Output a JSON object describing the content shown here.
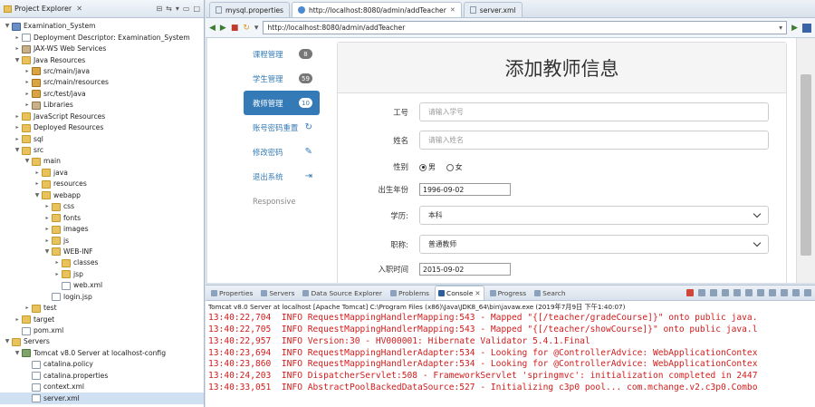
{
  "explorer": {
    "title": "Project Explorer",
    "tree": [
      {
        "label": "Examination_System",
        "depth": 0,
        "tw": "▼",
        "icon": "project"
      },
      {
        "label": "Deployment Descriptor: Examination_System",
        "depth": 1,
        "tw": "▸",
        "icon": "file"
      },
      {
        "label": "JAX-WS Web Services",
        "depth": 1,
        "tw": "▸",
        "icon": "lib"
      },
      {
        "label": "Java Resources",
        "depth": 1,
        "tw": "▼",
        "icon": "folder"
      },
      {
        "label": "src/main/java",
        "depth": 2,
        "tw": "▸",
        "icon": "pkg"
      },
      {
        "label": "src/main/resources",
        "depth": 2,
        "tw": "▸",
        "icon": "pkg"
      },
      {
        "label": "src/test/java",
        "depth": 2,
        "tw": "▸",
        "icon": "pkg"
      },
      {
        "label": "Libraries",
        "depth": 2,
        "tw": "▸",
        "icon": "lib"
      },
      {
        "label": "JavaScript Resources",
        "depth": 1,
        "tw": "▸",
        "icon": "folder"
      },
      {
        "label": "Deployed Resources",
        "depth": 1,
        "tw": "▸",
        "icon": "folder"
      },
      {
        "label": "sql",
        "depth": 1,
        "tw": "▸",
        "icon": "folder"
      },
      {
        "label": "src",
        "depth": 1,
        "tw": "▼",
        "icon": "folder"
      },
      {
        "label": "main",
        "depth": 2,
        "tw": "▼",
        "icon": "folder"
      },
      {
        "label": "java",
        "depth": 3,
        "tw": "▸",
        "icon": "folder"
      },
      {
        "label": "resources",
        "depth": 3,
        "tw": "▸",
        "icon": "folder"
      },
      {
        "label": "webapp",
        "depth": 3,
        "tw": "▼",
        "icon": "folder"
      },
      {
        "label": "css",
        "depth": 4,
        "tw": "▸",
        "icon": "folder"
      },
      {
        "label": "fonts",
        "depth": 4,
        "tw": "▸",
        "icon": "folder"
      },
      {
        "label": "images",
        "depth": 4,
        "tw": "▸",
        "icon": "folder"
      },
      {
        "label": "js",
        "depth": 4,
        "tw": "▸",
        "icon": "folder"
      },
      {
        "label": "WEB-INF",
        "depth": 4,
        "tw": "▼",
        "icon": "folder"
      },
      {
        "label": "classes",
        "depth": 5,
        "tw": "▸",
        "icon": "folder"
      },
      {
        "label": "jsp",
        "depth": 5,
        "tw": "▸",
        "icon": "folder"
      },
      {
        "label": "web.xml",
        "depth": 5,
        "tw": "",
        "icon": "file"
      },
      {
        "label": "login.jsp",
        "depth": 4,
        "tw": "",
        "icon": "file"
      },
      {
        "label": "test",
        "depth": 2,
        "tw": "▸",
        "icon": "folder"
      },
      {
        "label": "target",
        "depth": 1,
        "tw": "▸",
        "icon": "folder"
      },
      {
        "label": "pom.xml",
        "depth": 1,
        "tw": "",
        "icon": "file"
      },
      {
        "label": "Servers",
        "depth": 0,
        "tw": "▼",
        "icon": "folder"
      },
      {
        "label": "Tomcat v8.0 Server at localhost-config",
        "depth": 1,
        "tw": "▼",
        "icon": "server"
      },
      {
        "label": "catalina.policy",
        "depth": 2,
        "tw": "",
        "icon": "file"
      },
      {
        "label": "catalina.properties",
        "depth": 2,
        "tw": "",
        "icon": "file"
      },
      {
        "label": "context.xml",
        "depth": 2,
        "tw": "",
        "icon": "file"
      },
      {
        "label": "server.xml",
        "depth": 2,
        "tw": "",
        "icon": "file",
        "selected": true
      }
    ]
  },
  "editor_tabs": [
    {
      "label": "mysql.properties",
      "active": false
    },
    {
      "label": "http://localhost:8080/admin/addTeacher",
      "active": true
    },
    {
      "label": "server.xml",
      "active": false
    }
  ],
  "browser": {
    "url": "http://localhost:8080/admin/addTeacher"
  },
  "webapp": {
    "nav": [
      {
        "label": "课程管理",
        "badge": "8",
        "active": false
      },
      {
        "label": "学生管理",
        "badge": "59",
        "active": false
      },
      {
        "label": "教师管理",
        "badge": "10",
        "active": true
      },
      {
        "label": "账号密码重置",
        "glyph": "↻"
      },
      {
        "label": "修改密码",
        "glyph": "✎"
      },
      {
        "label": "退出系统",
        "glyph": "⇥"
      }
    ],
    "responsive_label": "Responsive",
    "form_title": "添加教师信息",
    "form": {
      "id_label": "工号",
      "id_placeholder": "请输入学号",
      "name_label": "姓名",
      "name_placeholder": "请输入姓名",
      "gender_label": "性别",
      "gender_male": "男",
      "gender_female": "女",
      "gender_selected": "男",
      "birth_label": "出生年份",
      "birth_value": "1996-09-02",
      "degree_label": "学历:",
      "degree_value": "本科",
      "title_label": "职称:",
      "title_value": "普通教师",
      "hire_label": "入职时间",
      "hire_value": "2015-09-02"
    }
  },
  "console_tabs": [
    {
      "label": "Properties",
      "active": false
    },
    {
      "label": "Servers",
      "active": false
    },
    {
      "label": "Data Source Explorer",
      "active": false
    },
    {
      "label": "Problems",
      "active": false
    },
    {
      "label": "Console",
      "active": true,
      "closable": true
    },
    {
      "label": "Progress",
      "active": false
    },
    {
      "label": "Search",
      "active": false
    }
  ],
  "console": {
    "server_line": "Tomcat v8.0 Server at localhost [Apache Tomcat] C:\\Program Files (x86)\\Java\\JDK8_64\\bin\\javaw.exe (2019年7月9日 下午1:40:07)",
    "lines": [
      "13:40:22,704  INFO RequestMappingHandlerMapping:543 - Mapped \"{[/teacher/gradeCourse]}\" onto public java.",
      "13:40:22,705  INFO RequestMappingHandlerMapping:543 - Mapped \"{[/teacher/showCourse]}\" onto public java.l",
      "13:40:22,957  INFO Version:30 - HV000001: Hibernate Validator 5.4.1.Final",
      "13:40:23,694  INFO RequestMappingHandlerAdapter:534 - Looking for @ControllerAdvice: WebApplicationContex",
      "13:40:23,860  INFO RequestMappingHandlerAdapter:534 - Looking for @ControllerAdvice: WebApplicationContex",
      "13:40:24,203  INFO DispatcherServlet:508 - FrameworkServlet 'springmvc': initialization completed in 2447",
      "13:40:33,051  INFO AbstractPoolBackedDataSource:527 - Initializing c3p0 pool... com.mchange.v2.c3p0.Combo"
    ]
  }
}
